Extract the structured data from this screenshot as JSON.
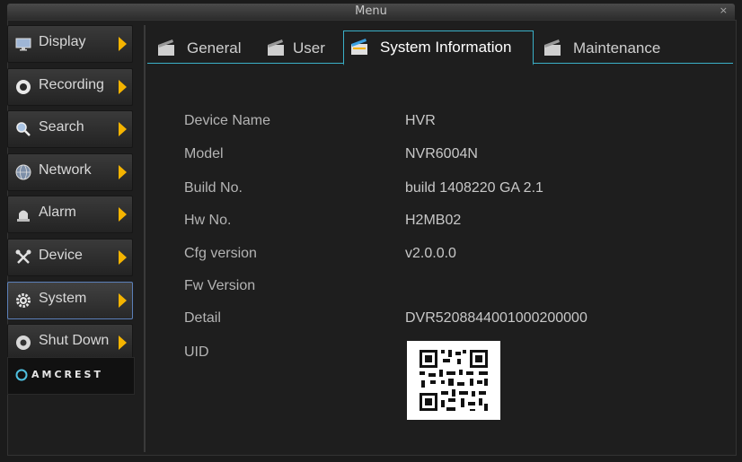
{
  "window": {
    "title": "Menu",
    "close_label": "×"
  },
  "sidebar": {
    "items": [
      {
        "label": "Display",
        "icon": "monitor-icon"
      },
      {
        "label": "Recording",
        "icon": "record-icon"
      },
      {
        "label": "Search",
        "icon": "magnifier-icon"
      },
      {
        "label": "Network",
        "icon": "globe-icon"
      },
      {
        "label": "Alarm",
        "icon": "alarm-icon"
      },
      {
        "label": "Device",
        "icon": "tools-icon"
      },
      {
        "label": "System",
        "icon": "gear-icon",
        "active": true
      },
      {
        "label": "Shut Down",
        "icon": "power-icon"
      }
    ],
    "logo": "AMCREST"
  },
  "tabs": [
    {
      "label": "General"
    },
    {
      "label": "User"
    },
    {
      "label": "System Information",
      "active": true
    },
    {
      "label": "Maintenance"
    }
  ],
  "system_info": {
    "rows": [
      {
        "label": "Device Name",
        "value": "HVR"
      },
      {
        "label": "Model",
        "value": "NVR6004N"
      },
      {
        "label": "Build No.",
        "value": "build 1408220 GA 2.1"
      },
      {
        "label": "Hw No.",
        "value": "H2MB02"
      },
      {
        "label": "Cfg version",
        "value": "v2.0.0.0"
      },
      {
        "label": "Fw Version",
        "value": ""
      },
      {
        "label": "Detail",
        "value": "DVR5208844001000200000"
      },
      {
        "label": "UID",
        "value": ""
      }
    ]
  },
  "colors": {
    "accent_tab": "#3ab0c8",
    "arrow": "#f5b400",
    "active_border": "#5b7fb8"
  }
}
